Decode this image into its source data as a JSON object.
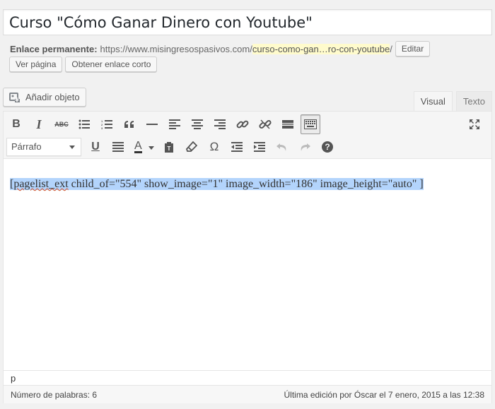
{
  "post": {
    "title": "Curso \"Cómo Ganar Dinero con Youtube\""
  },
  "permalink": {
    "label": "Enlace permanente:",
    "base_url": "https://www.misingresospasivos.com/",
    "slug": "curso-como-gan…ro-con-youtube",
    "trailing": "/",
    "edit_button": "Editar",
    "view_button": "Ver página",
    "shortlink_button": "Obtener enlace corto"
  },
  "media": {
    "add_button": "Añadir objeto"
  },
  "tabs": [
    {
      "label": "Visual",
      "active": true
    },
    {
      "label": "Texto",
      "active": false
    }
  ],
  "toolbar": {
    "row1": [
      "bold-icon",
      "italic-icon",
      "strikethrough-icon",
      "bullet-list-icon",
      "numbered-list-icon",
      "blockquote-icon",
      "horizontal-line-icon",
      "align-left-icon",
      "align-center-icon",
      "align-right-icon",
      "link-icon",
      "unlink-icon",
      "read-more-icon",
      "toolbar-toggle-icon"
    ],
    "row2": [
      "underline-icon",
      "justify-icon",
      "text-color-icon",
      "paste-text-icon",
      "clear-formatting-icon",
      "special-character-icon",
      "outdent-icon",
      "indent-icon",
      "undo-icon",
      "redo-icon",
      "help-icon"
    ],
    "format_value": "Párrafo",
    "bold_glyph": "B",
    "italic_glyph": "I",
    "strike_glyph": "ABC",
    "underline_glyph": "U",
    "textcolor_glyph": "A",
    "special_glyph": "Ω",
    "help_glyph": "?"
  },
  "content": {
    "shortcode_open": "[",
    "shortcode_name": "pagelist_ext",
    "shortcode_rest": " child_of=\"554\" show_image=\"1\" image_width=\"186\" image_height=\"auto\" ]"
  },
  "path": "p",
  "status": {
    "word_count": "Número de palabras: 6",
    "last_edit": "Última edición por Óscar el 7 enero, 2015 a las 12:38"
  }
}
